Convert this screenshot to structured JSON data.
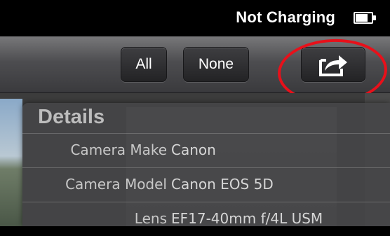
{
  "status_bar": {
    "charging_text": "Not Charging",
    "battery_icon": "battery-icon"
  },
  "toolbar": {
    "all_label": "All",
    "none_label": "None",
    "share_icon": "share-export-icon"
  },
  "annotation": {
    "circle_color": "#e8101a"
  },
  "details": {
    "title": "Details",
    "rows": [
      {
        "label": "Camera Make",
        "value": "Canon"
      },
      {
        "label": "Camera Model",
        "value": "Canon EOS 5D"
      },
      {
        "label": "Lens",
        "value": "EF17-40mm f/4L USM"
      }
    ]
  }
}
